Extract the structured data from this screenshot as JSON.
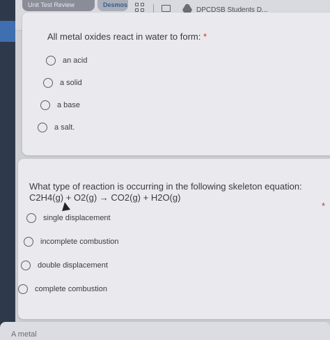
{
  "bookmarks": {
    "review_label": "Unit Test Review",
    "desmos_label": "Desmos",
    "students_label": "DPCDSB Students D..."
  },
  "question1": {
    "title": "All metal oxides react in water to form:",
    "required_mark": "*",
    "options": [
      "an acid",
      "a solid",
      "a base",
      "a salt."
    ]
  },
  "question2": {
    "title_line1": "What type of reaction is occurring in the following skeleton equation:",
    "title_line2": "C2H4(g) + O2(g) → CO2(g) + H2O(g)",
    "required_mark": "*",
    "options": [
      "single displacement",
      "incomplete combustion",
      "double displacement",
      "complete combustion"
    ]
  },
  "question3": {
    "partial_text": "A metal"
  }
}
